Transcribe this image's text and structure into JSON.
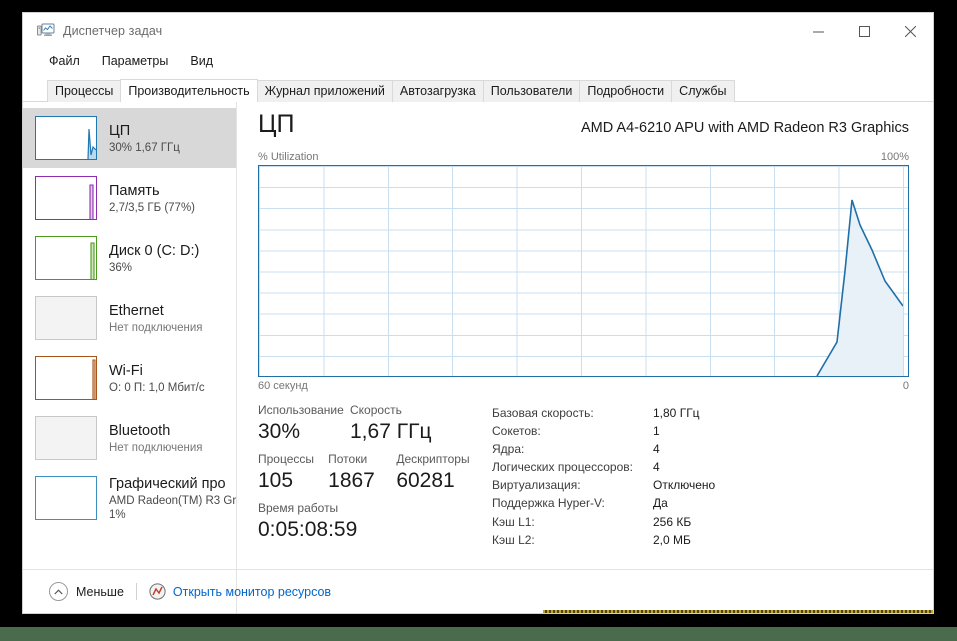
{
  "window": {
    "title": "Диспетчер задач",
    "icon": "task-manager-icon",
    "minimize": "—",
    "maximize": "▢",
    "close": "✕"
  },
  "menu": [
    "Файл",
    "Параметры",
    "Вид"
  ],
  "tabs": [
    {
      "label": "Процессы",
      "active": false
    },
    {
      "label": "Производительность",
      "active": true
    },
    {
      "label": "Журнал приложений",
      "active": false
    },
    {
      "label": "Автозагрузка",
      "active": false
    },
    {
      "label": "Пользователи",
      "active": false
    },
    {
      "label": "Подробности",
      "active": false
    },
    {
      "label": "Службы",
      "active": false
    }
  ],
  "sidebar": {
    "items": [
      {
        "title": "ЦП",
        "sub": "30%  1,67 ГГц",
        "sub2": "",
        "color": "#1f78b4",
        "selected": true,
        "dim": false
      },
      {
        "title": "Память",
        "sub": "2,7/3,5 ГБ (77%)",
        "sub2": "",
        "color": "#8e2eae",
        "selected": false,
        "dim": false
      },
      {
        "title": "Диск 0 (C: D:)",
        "sub": "36%",
        "sub2": "",
        "color": "#4a9b1f",
        "selected": false,
        "dim": false
      },
      {
        "title": "Ethernet",
        "sub": "Нет подключения",
        "sub2": "",
        "color": "#cccccc",
        "selected": false,
        "dim": true
      },
      {
        "title": "Wi-Fi",
        "sub": "О: 0 П: 1,0 Мбит/с",
        "sub2": "",
        "color": "#a65418",
        "selected": false,
        "dim": false
      },
      {
        "title": "Bluetooth",
        "sub": "Нет подключения",
        "sub2": "",
        "color": "#cccccc",
        "selected": false,
        "dim": true
      },
      {
        "title": "Графический про",
        "sub": "AMD Radeon(TM) R3 Gr",
        "sub2": "1%",
        "color": "#1f78b4",
        "selected": false,
        "dim": false
      }
    ]
  },
  "main": {
    "heading": "ЦП",
    "model": "AMD A4-6210 APU with AMD Radeon R3 Graphics",
    "chart_top_left": "% Utilization",
    "chart_top_right": "100%",
    "chart_bottom_left": "60 секунд",
    "chart_bottom_right": "0"
  },
  "chart_data": {
    "type": "area",
    "title": "% Utilization",
    "xlabel": "60 секунд",
    "ylabel": "% Utilization",
    "ylim": [
      0,
      100
    ],
    "xlim": [
      0,
      60
    ],
    "grid": true,
    "line_color": "#1f6fa8",
    "fill_color": "#e8f1f8",
    "legend": "none",
    "x": [
      0,
      52.0,
      53.8,
      54.5,
      55.2,
      56.0,
      57.2,
      58.4,
      60.0
    ],
    "values": [
      0,
      0,
      17,
      50,
      84,
      72,
      60,
      45,
      32
    ]
  },
  "stats": {
    "usage": {
      "cap": "Использование",
      "val": "30%"
    },
    "speed": {
      "cap": "Скорость",
      "val": "1,67 ГГц"
    },
    "processes": {
      "cap": "Процессы",
      "val": "105"
    },
    "threads": {
      "cap": "Потоки",
      "val": "1867"
    },
    "handles": {
      "cap": "Дескрипторы",
      "val": "60281"
    },
    "uptime": {
      "cap": "Время работы",
      "val": "0:05:08:59"
    }
  },
  "details": [
    {
      "key": "Базовая скорость:",
      "value": "1,80 ГГц"
    },
    {
      "key": "Сокетов:",
      "value": "1"
    },
    {
      "key": "Ядра:",
      "value": "4"
    },
    {
      "key": "Логических процессоров:",
      "value": "4"
    },
    {
      "key": "Виртуализация:",
      "value": "Отключено"
    },
    {
      "key": "Поддержка Hyper-V:",
      "value": "Да"
    },
    {
      "key": "Кэш L1:",
      "value": "256 КБ"
    },
    {
      "key": "Кэш L2:",
      "value": "2,0 МБ"
    }
  ],
  "footer": {
    "less_label": "Меньше",
    "less_icon": "chevron-up-circle-icon",
    "resmon_label": "Открыть монитор ресурсов",
    "resmon_icon": "resource-monitor-icon",
    "link_color": "#0066cc"
  }
}
